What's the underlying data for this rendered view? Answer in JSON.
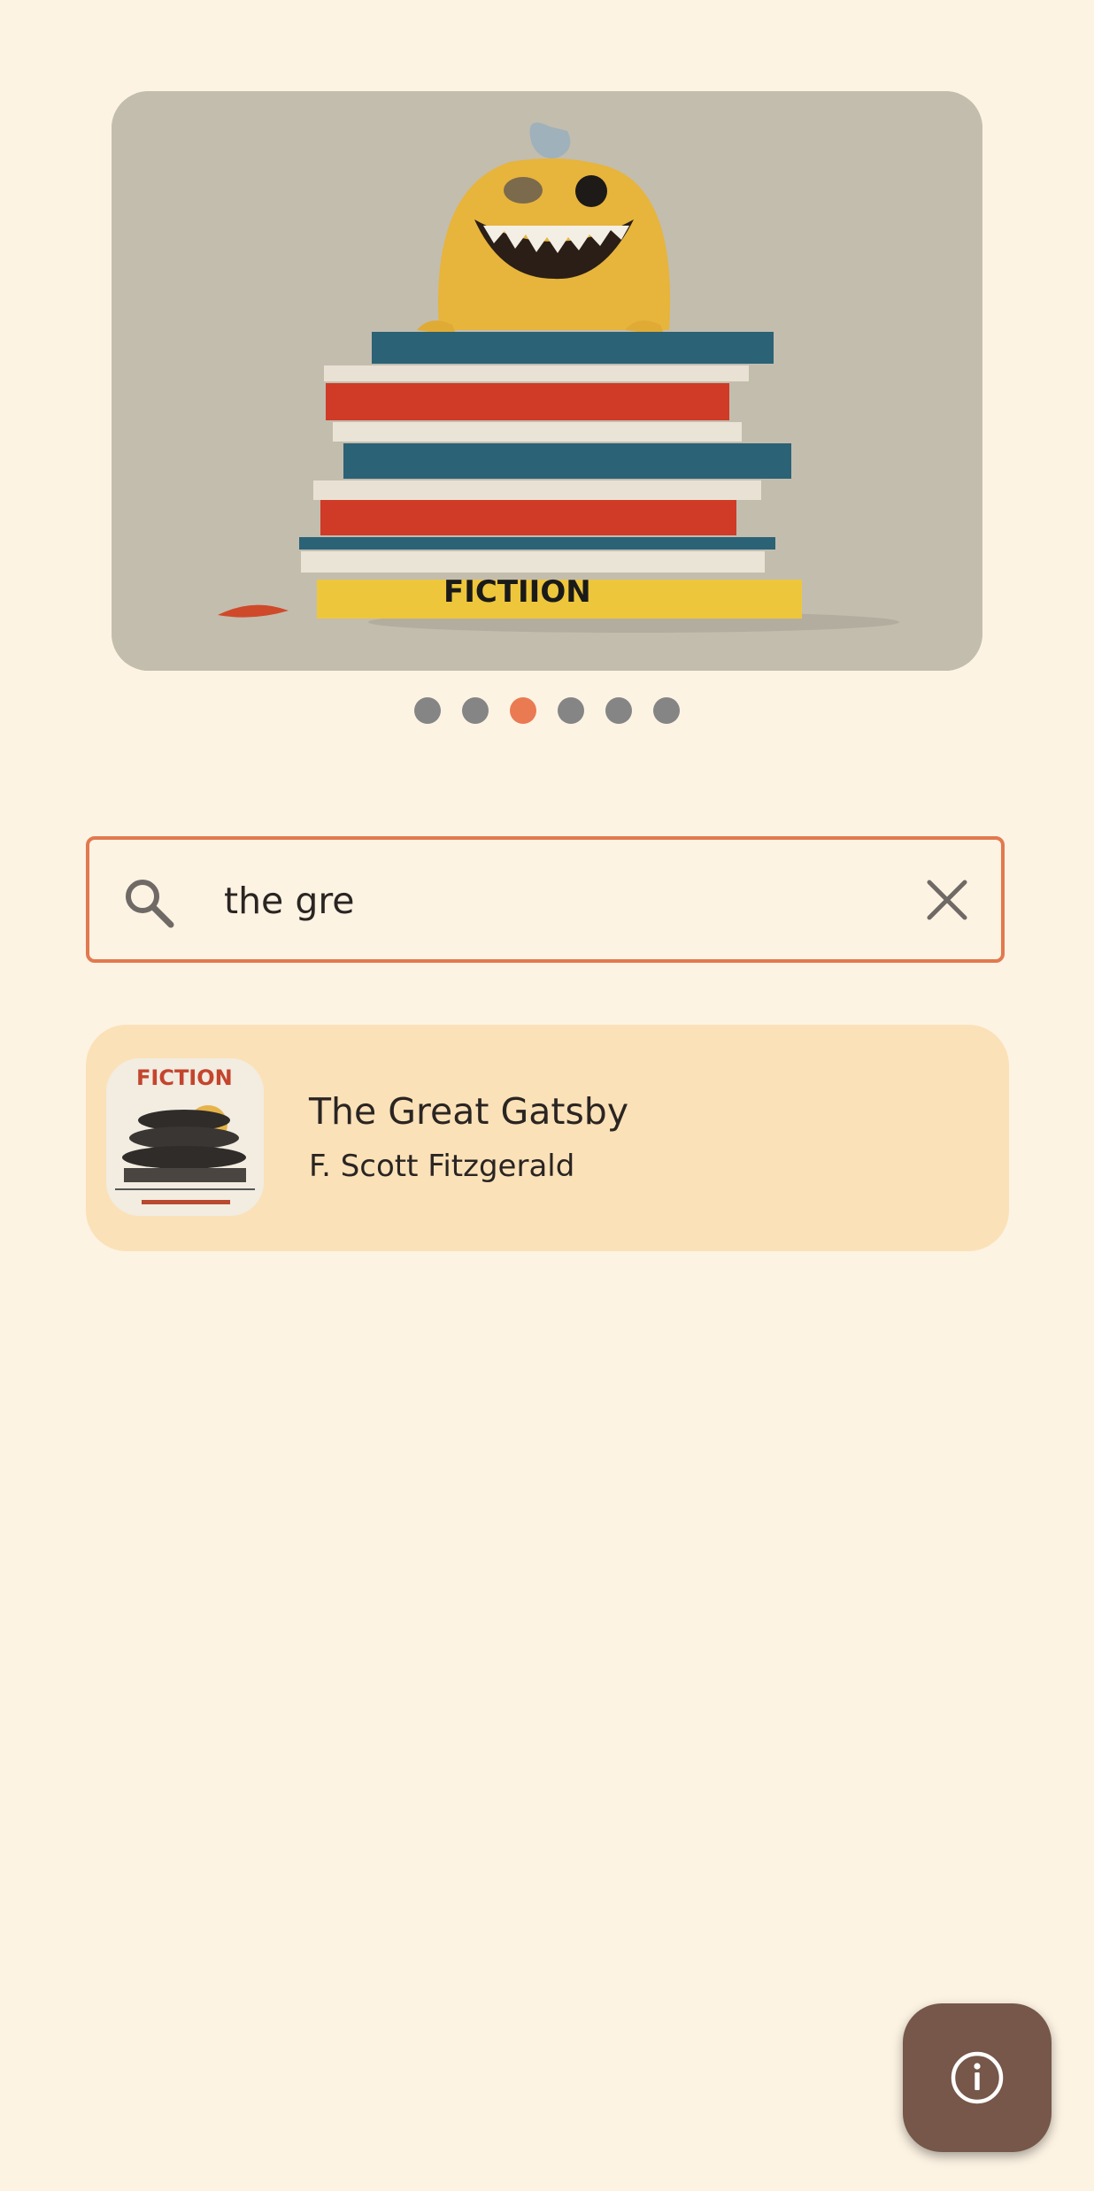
{
  "carousel": {
    "image": {
      "cover_text": "FICTIION",
      "description_icon": "book-stack-monster-illustration"
    },
    "dots_count": 6,
    "active_dot_index": 2,
    "colors": {
      "dot_inactive": "#858585",
      "dot_active": "#ea7a52"
    }
  },
  "search": {
    "icon": "search-icon",
    "value": "the gre",
    "clear_icon": "close-icon",
    "border_color": "#e2794f"
  },
  "results": [
    {
      "title": "The Great Gatsby",
      "author": "F. Scott Fitzgerald",
      "cover_text": "FICTION",
      "background": "#fbe1b8"
    }
  ],
  "fab": {
    "icon": "info-icon",
    "background": "#76574a"
  },
  "colors": {
    "page_background": "#fdf3e3",
    "text_primary": "#2a2522"
  }
}
